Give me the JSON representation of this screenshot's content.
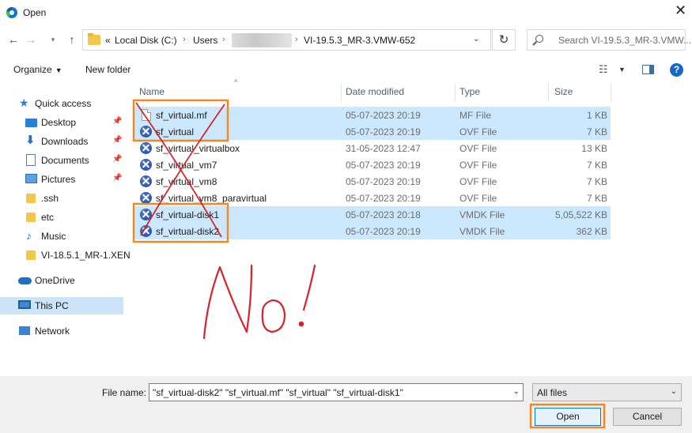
{
  "window": {
    "title": "Open"
  },
  "address_bar": {
    "overflow": "«",
    "crumbs": [
      "Local Disk (C:)",
      "Users",
      "VI-19.5.3_MR-3.VMW-652"
    ]
  },
  "search": {
    "placeholder": "Search VI-19.5.3_MR-3.VMW..."
  },
  "toolbar": {
    "organize": "Organize",
    "new_folder": "New folder"
  },
  "sidebar": {
    "quick_access": "Quick access",
    "items": [
      "Desktop",
      "Downloads",
      "Documents",
      "Pictures",
      ".ssh",
      "etc",
      "Music",
      "VI-18.5.1_MR-1.XEN"
    ],
    "onedrive": "OneDrive",
    "this_pc": "This PC",
    "network": "Network"
  },
  "columns": {
    "name": "Name",
    "date": "Date modified",
    "type": "Type",
    "size": "Size"
  },
  "files": [
    {
      "name": "sf_virtual.mf",
      "date": "05-07-2023 20:19",
      "type": "MF File",
      "size": "1 KB",
      "icon": "blank-file-icon",
      "selected": true
    },
    {
      "name": "sf_virtual",
      "date": "05-07-2023 20:19",
      "type": "OVF File",
      "size": "7 KB",
      "icon": "vm-file-icon",
      "selected": true
    },
    {
      "name": "sf_virtual_virtualbox",
      "date": "31-05-2023 12:47",
      "type": "OVF File",
      "size": "13 KB",
      "icon": "vm-file-icon",
      "selected": false
    },
    {
      "name": "sf_virtual_vm7",
      "date": "05-07-2023 20:19",
      "type": "OVF File",
      "size": "7 KB",
      "icon": "vm-file-icon",
      "selected": false
    },
    {
      "name": "sf_virtual_vm8",
      "date": "05-07-2023 20:19",
      "type": "OVF File",
      "size": "7 KB",
      "icon": "vm-file-icon",
      "selected": false
    },
    {
      "name": "sf_virtual_vm8_paravirtual",
      "date": "05-07-2023 20:19",
      "type": "OVF File",
      "size": "7 KB",
      "icon": "vm-file-icon",
      "selected": false
    },
    {
      "name": "sf_virtual-disk1",
      "date": "05-07-2023 20:18",
      "type": "VMDK File",
      "size": "5,05,522 KB",
      "icon": "vm-file-icon",
      "selected": true
    },
    {
      "name": "sf_virtual-disk2",
      "date": "05-07-2023 20:19",
      "type": "VMDK File",
      "size": "362 KB",
      "icon": "vm-file-icon",
      "selected": true
    }
  ],
  "bottom": {
    "file_name_label": "File name:",
    "file_name_value": "\"sf_virtual-disk2\" \"sf_virtual.mf\" \"sf_virtual\" \"sf_virtual-disk1\"",
    "file_type": "All files",
    "open_label": "Open",
    "cancel_label": "Cancel"
  },
  "colors": {
    "selection": "#cce8ff",
    "annotation_red": "#d8232a",
    "annotation_orange": "#f08a24"
  }
}
